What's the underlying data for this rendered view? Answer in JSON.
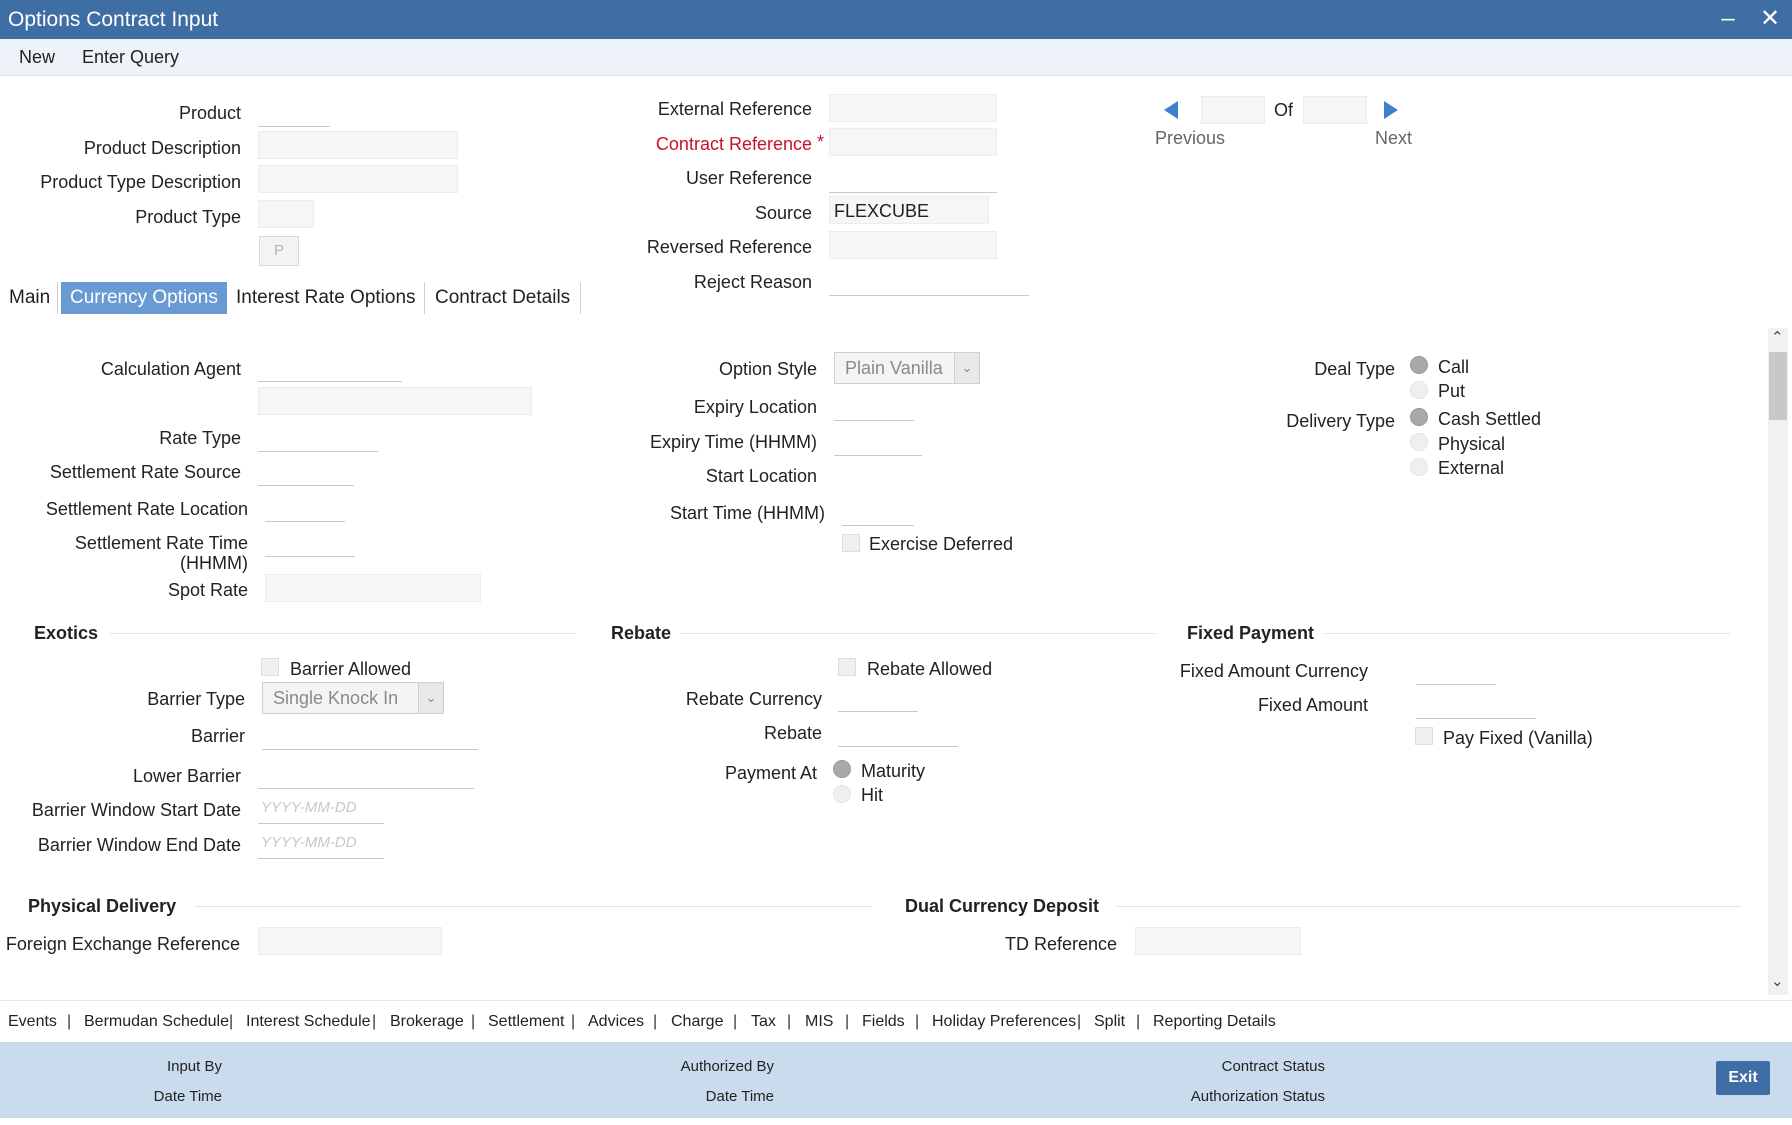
{
  "window": {
    "title": "Options Contract Input",
    "minimize_icon": "minimize-icon",
    "close_icon": "close-icon"
  },
  "menu": {
    "new": "New",
    "enter_query": "Enter Query"
  },
  "header": {
    "product": "Product",
    "product_description": "Product Description",
    "product_type_description": "Product Type Description",
    "product_type": "Product Type",
    "product_type_button": "P",
    "external_reference": "External Reference",
    "contract_reference": "Contract Reference",
    "required_mark": "*",
    "user_reference": "User Reference",
    "source": "Source",
    "source_value": "FLEXCUBE",
    "reversed_reference": "Reversed Reference",
    "reject_reason": "Reject Reason",
    "of": "Of",
    "previous": "Previous",
    "next": "Next"
  },
  "tabs": [
    "Main",
    "Currency Options",
    "Interest Rate Options",
    "Contract Details"
  ],
  "active_tab": "Currency Options",
  "currency_options": {
    "calculation_agent": "Calculation Agent",
    "rate_type": "Rate Type",
    "settlement_rate_source": "Settlement Rate Source",
    "settlement_rate_location": "Settlement Rate Location",
    "settlement_rate_time_1": "Settlement Rate Time",
    "settlement_rate_time_2": "(HHMM)",
    "spot_rate": "Spot Rate",
    "option_style": "Option Style",
    "option_style_value": "Plain Vanilla",
    "expiry_location": "Expiry Location",
    "expiry_time": "Expiry Time (HHMM)",
    "start_location": "Start Location",
    "start_time": "Start Time (HHMM)",
    "exercise_deferred": "Exercise Deferred",
    "deal_type": "Deal Type",
    "call": "Call",
    "put": "Put",
    "delivery_type": "Delivery Type",
    "cash_settled": "Cash Settled",
    "physical": "Physical",
    "external": "External"
  },
  "exotics": {
    "heading": "Exotics",
    "barrier_allowed": "Barrier Allowed",
    "barrier_type": "Barrier Type",
    "barrier_type_value": "Single Knock In",
    "barrier": "Barrier",
    "lower_barrier": "Lower Barrier",
    "barrier_window_start_date": "Barrier Window Start Date",
    "barrier_window_end_date": "Barrier Window End Date",
    "date_placeholder": "YYYY-MM-DD"
  },
  "rebate": {
    "heading": "Rebate",
    "rebate_allowed": "Rebate Allowed",
    "rebate_currency": "Rebate Currency",
    "rebate": "Rebate",
    "payment_at": "Payment At",
    "maturity": "Maturity",
    "hit": "Hit"
  },
  "fixed_payment": {
    "heading": "Fixed Payment",
    "fixed_amount_currency": "Fixed Amount Currency",
    "fixed_amount": "Fixed Amount",
    "pay_fixed_vanilla": "Pay Fixed (Vanilla)"
  },
  "physical_delivery": {
    "heading": "Physical Delivery",
    "foreign_exchange_reference": "Foreign Exchange Reference"
  },
  "dual_currency_deposit": {
    "heading": "Dual Currency Deposit",
    "td_reference": "TD Reference"
  },
  "bottom_nav": [
    "Events",
    "Bermudan Schedule",
    "Interest Schedule",
    "Brokerage",
    "Settlement",
    "Advices",
    "Charge",
    "Tax",
    "MIS",
    "Fields",
    "Holiday Preferences",
    "Split",
    "Reporting Details"
  ],
  "footer": {
    "input_by": "Input By",
    "date_time": "Date Time",
    "authorized_by": "Authorized By",
    "contract_status": "Contract Status",
    "authorization_status": "Authorization Status",
    "exit": "Exit"
  },
  "colors": {
    "title_bar": "#3f6ea5",
    "active_tab": "#6a9ad3",
    "required": "#c8102e",
    "footer": "#c9dbec"
  }
}
